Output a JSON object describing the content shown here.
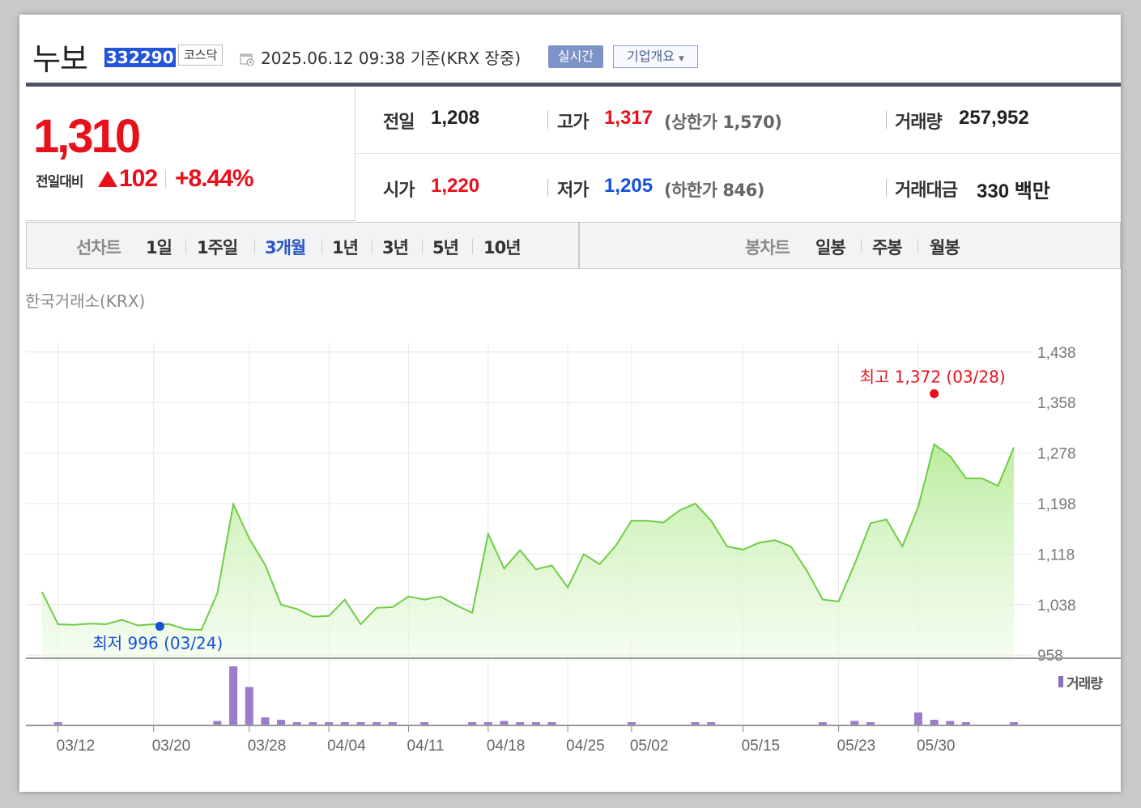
{
  "header": {
    "stock_name": "누보",
    "stock_code": "332290",
    "market": "코스닥",
    "timestamp": "2025.06.12 09:38  기준(KRX 장중)",
    "realtime_label": "실시간",
    "company_label": "기업개요"
  },
  "price": {
    "current": "1,310",
    "change_label": "전일대비",
    "change_amount": "102",
    "change_rate": "+8.44%"
  },
  "stats": {
    "prev_close_label": "전일",
    "prev_close": "1,208",
    "high_label": "고가",
    "high": "1,317",
    "upper_limit": "(상한가 1,570)",
    "volume_label": "거래량",
    "volume": "257,952",
    "open_label": "시가",
    "open": "1,220",
    "low_label": "저가",
    "low": "1,205",
    "lower_limit": "(하한가 846)",
    "trade_value_label": "거래대금",
    "trade_value": "330 백만"
  },
  "tabs": {
    "line_chart_label": "선차트",
    "line_periods": [
      "1일",
      "1주일",
      "3개월",
      "1년",
      "3년",
      "5년",
      "10년"
    ],
    "active_period": "3개월",
    "candle_chart_label": "봉차트",
    "candle_periods": [
      "일봉",
      "주봉",
      "월봉"
    ]
  },
  "chart_data": {
    "type": "area",
    "exchange_label": "한국거래소(KRX)",
    "high_annotation": "최고  1,372 (03/28)",
    "low_annotation": "최저  996 (03/24)",
    "high_value": 1372,
    "low_value": 996,
    "y_ticks": [
      "1,438",
      "1,358",
      "1,278",
      "1,198",
      "1,118",
      "1,038",
      "958"
    ],
    "ylim": [
      948,
      1448
    ],
    "x_ticks": [
      "03/12",
      "03/20",
      "03/28",
      "04/04",
      "04/11",
      "04/18",
      "04/25",
      "05/02",
      "05/15",
      "05/23",
      "05/30"
    ],
    "x_tick_index": [
      1,
      7,
      13,
      18,
      23,
      28,
      33,
      37,
      44,
      50,
      55
    ],
    "grid": true,
    "series": [
      {
        "values": [
          1058,
          1007,
          1006,
          1008,
          1007,
          1014,
          1005,
          1007,
          1007,
          999,
          998,
          1056,
          1197,
          1143,
          1101,
          1038,
          1031,
          1019,
          1020,
          1046,
          1007,
          1033,
          1034,
          1051,
          1046,
          1051,
          1037,
          1025,
          1150,
          1095,
          1124,
          1094,
          1100,
          1065,
          1118,
          1102,
          1131,
          1171,
          1171,
          1168,
          1187,
          1198,
          1171,
          1130,
          1125,
          1136,
          1140,
          1130,
          1092,
          1046,
          1043,
          1102,
          1167,
          1173,
          1130,
          1193,
          1292,
          1273,
          1238,
          1238,
          1226,
          1287
        ]
      }
    ],
    "volume_label": "거래량",
    "volume": [
      0,
      2,
      0,
      0,
      0,
      0,
      0,
      0,
      0,
      0,
      0,
      3,
      48,
      31,
      6,
      4,
      2,
      2,
      2,
      2,
      2,
      2,
      2,
      0,
      2,
      0,
      0,
      2,
      2,
      3,
      2,
      2,
      2,
      0,
      0,
      0,
      0,
      2,
      0,
      0,
      0,
      2,
      2,
      0,
      0,
      0,
      0,
      0,
      0,
      2,
      0,
      3,
      2,
      0,
      0,
      10,
      4,
      3,
      2,
      0,
      0,
      2
    ],
    "volume_max": 48
  },
  "colors": {
    "up": "#e8101b",
    "down": "#1550d8",
    "line": "#6fcd45",
    "volume": "#9c7ccc",
    "active_tab": "#2a56c6"
  }
}
